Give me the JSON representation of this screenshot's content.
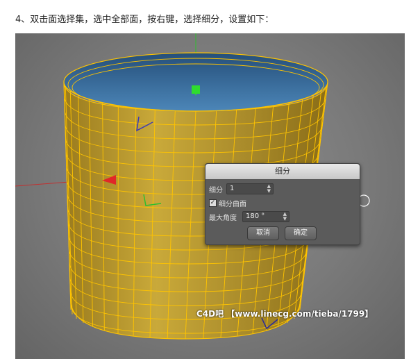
{
  "step_text": "4、双击面选择集，选中全部面，按右键，选择细分，设置如下：",
  "dialog": {
    "title": "细分",
    "subdivision_label": "细分",
    "subdivision_value": "1",
    "smooth_label": "细分曲面",
    "smooth_checked": true,
    "max_angle_label": "最大角度",
    "max_angle_value": "180 °",
    "cancel_label": "取消",
    "ok_label": "确定"
  },
  "watermark": "C4D吧 【www.linecg.com/tieba/1799】",
  "colors": {
    "mesh_fill": "#b8962a",
    "wire": "#ffc400",
    "inside": "#2e6fa6",
    "dialog_bg": "#5b5b5b"
  }
}
